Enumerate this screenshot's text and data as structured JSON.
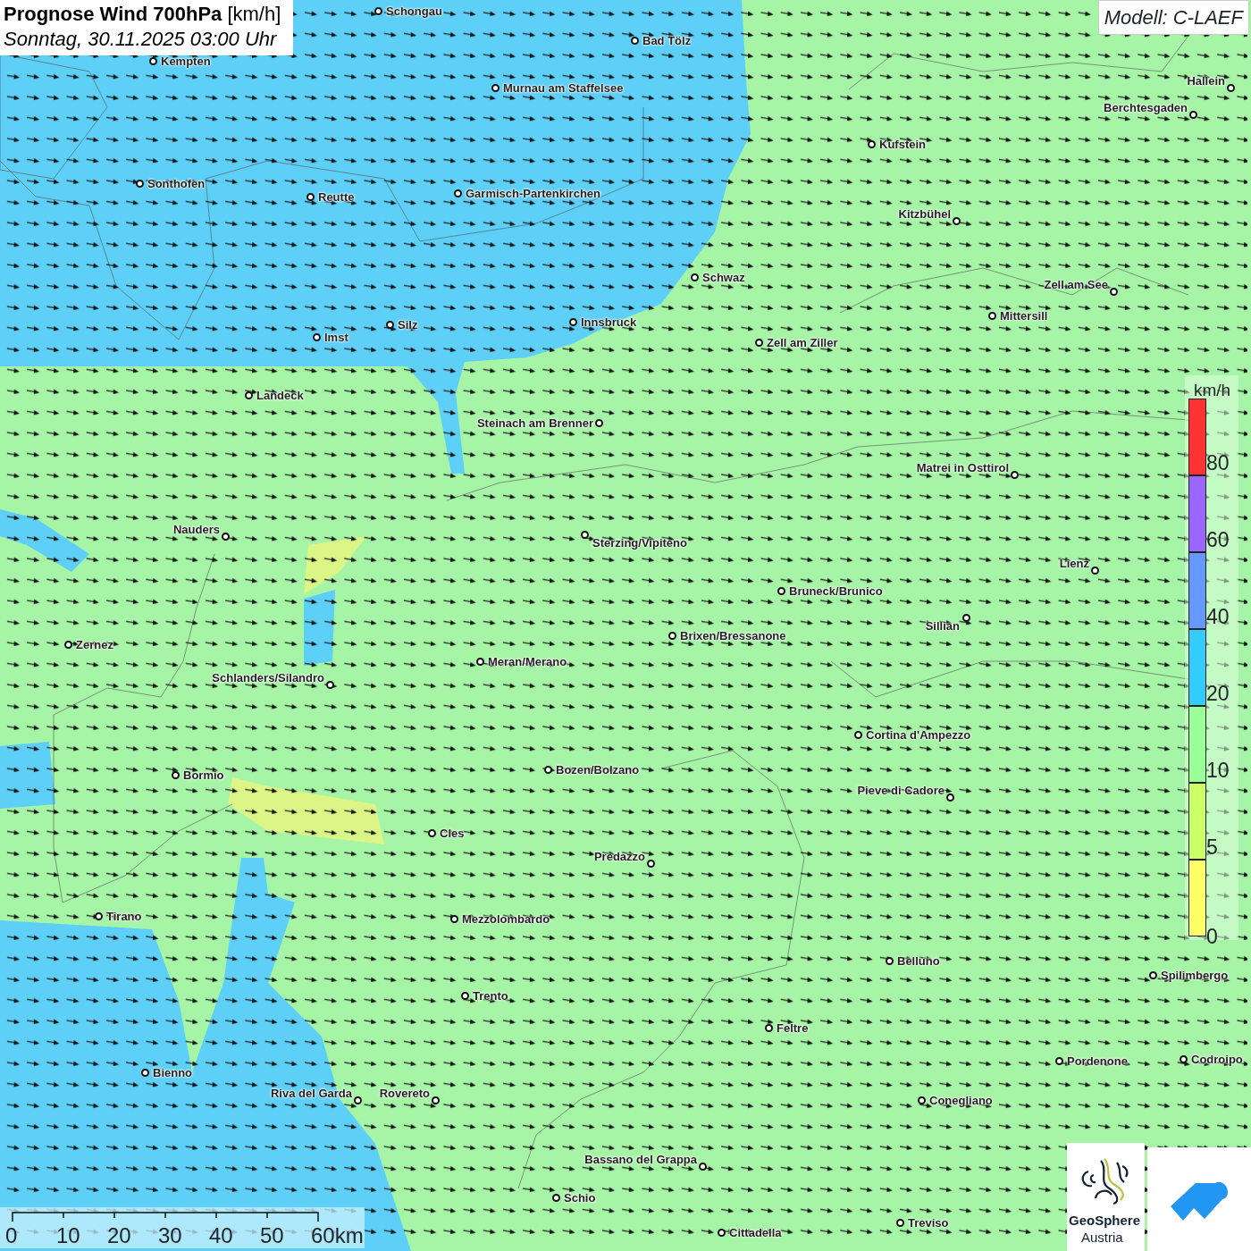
{
  "header": {
    "title": "**Prognose Wind 700hPa** [km/h]",
    "subtitle": "Sonntag, 30.11.2025 03:00 Uhr"
  },
  "model": "Modell: C-LAEF",
  "cities": [
    {
      "name": "Schongau"
    },
    {
      "name": "Bad Tölz"
    },
    {
      "name": "Kempten"
    },
    {
      "name": "Murnau am Staffelsee"
    },
    {
      "name": "Hallein"
    },
    {
      "name": "Berchtesgaden"
    },
    {
      "name": "Kufstein"
    },
    {
      "name": "Sonthofen"
    },
    {
      "name": "Reutte"
    },
    {
      "name": "Garmisch-Partenkirchen"
    },
    {
      "name": "Kitzbühel"
    },
    {
      "name": "Schwaz"
    },
    {
      "name": "Zell am See"
    },
    {
      "name": "Innsbruck"
    },
    {
      "name": "Mittersill"
    },
    {
      "name": "Silz"
    },
    {
      "name": "Imst"
    },
    {
      "name": "Zell am Ziller"
    },
    {
      "name": "Landeck"
    },
    {
      "name": "Steinach am Brenner"
    },
    {
      "name": "Matrei in Osttirol"
    },
    {
      "name": "Nauders"
    },
    {
      "name": "Sterzing/Vipiteno"
    },
    {
      "name": "Lienz"
    },
    {
      "name": "Bruneck/Brunico"
    },
    {
      "name": "Sillian"
    },
    {
      "name": "Brixen/Bressanone"
    },
    {
      "name": "Zernez"
    },
    {
      "name": "Meran/Merano"
    },
    {
      "name": "Schlanders/Silandro"
    },
    {
      "name": "Cortina d'Ampezzo"
    },
    {
      "name": "Bozen/Bolzano"
    },
    {
      "name": "Bormio"
    },
    {
      "name": "Pieve di Cadore"
    },
    {
      "name": "Cles"
    },
    {
      "name": "Predazzo"
    },
    {
      "name": "Tirano"
    },
    {
      "name": "Mezzolombardo"
    },
    {
      "name": "Belluno"
    },
    {
      "name": "Spilimbergo"
    },
    {
      "name": "Trento"
    },
    {
      "name": "Feltre"
    },
    {
      "name": "Pordenone"
    },
    {
      "name": "Codroipo"
    },
    {
      "name": "Bienno"
    },
    {
      "name": "Riva del Garda"
    },
    {
      "name": "Rovereto"
    },
    {
      "name": "Conegliano"
    },
    {
      "name": "Bassano del Grappa"
    },
    {
      "name": "Schio"
    },
    {
      "name": "Treviso"
    },
    {
      "name": "Cittadella"
    }
  ],
  "legend": {
    "unit": "km/h",
    "bands": [
      {
        "color": "#ff3333",
        "label": "80"
      },
      {
        "color": "#9966ff",
        "label": "60"
      },
      {
        "color": "#6699ff",
        "label": "40"
      },
      {
        "color": "#33ccff",
        "label": "20"
      },
      {
        "color": "#99ff99",
        "label": "10"
      },
      {
        "color": "#ccff66",
        "label": "5"
      },
      {
        "color": "#ffff66",
        "label": "0"
      }
    ]
  },
  "scale_bar": {
    "labels": [
      "0",
      "10",
      "20",
      "30",
      "40",
      "50",
      "60km"
    ]
  },
  "logo": {
    "name": "GeoSphere",
    "country": "Austria"
  }
}
